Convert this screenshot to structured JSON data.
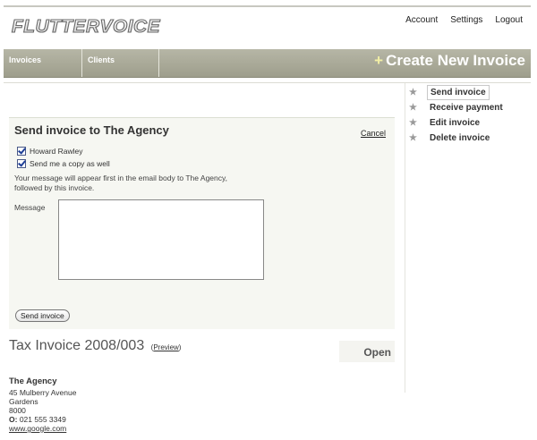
{
  "app": {
    "logo_text": "FLUTTERVOICE"
  },
  "top_links": {
    "account": "Account",
    "settings": "Settings",
    "logout": "Logout"
  },
  "nav": {
    "tabs": [
      {
        "label": "Invoices"
      },
      {
        "label": "Clients"
      }
    ],
    "create_plus": "+",
    "create_label": "Create New Invoice"
  },
  "actions": [
    {
      "label": "Send invoice",
      "active": true
    },
    {
      "label": "Receive payment"
    },
    {
      "label": "Edit invoice"
    },
    {
      "label": "Delete invoice"
    }
  ],
  "send_panel": {
    "title": "Send invoice to The Agency",
    "cancel": "Cancel",
    "recipients": [
      {
        "label": "Howard Rawley",
        "checked": true
      },
      {
        "label": "Send me a copy as well",
        "checked": true
      }
    ],
    "note": "Your message will appear first in the email body to The Agency, followed by this invoice.",
    "message_label": "Message",
    "message_value": "",
    "send_button": "Send invoice"
  },
  "invoice": {
    "title": "Tax Invoice 2008/003",
    "preview_open": "(",
    "preview_link": "Preview",
    "preview_close": ")",
    "status": "Open"
  },
  "client": {
    "name": "The Agency",
    "street": "45 Mulberry Avenue",
    "suburb": "Gardens",
    "postcode": "8000",
    "phone_label": "O:",
    "phone": "021 555 3349",
    "website": "www.google.com"
  },
  "colors": {
    "nav_bg": "#a8a898",
    "accent_plus": "#f3f0a6",
    "panel_bg": "#f6f7f2"
  },
  "icons": {
    "action_marker": "star-icon",
    "checkbox": "checkbox-checked-icon"
  }
}
